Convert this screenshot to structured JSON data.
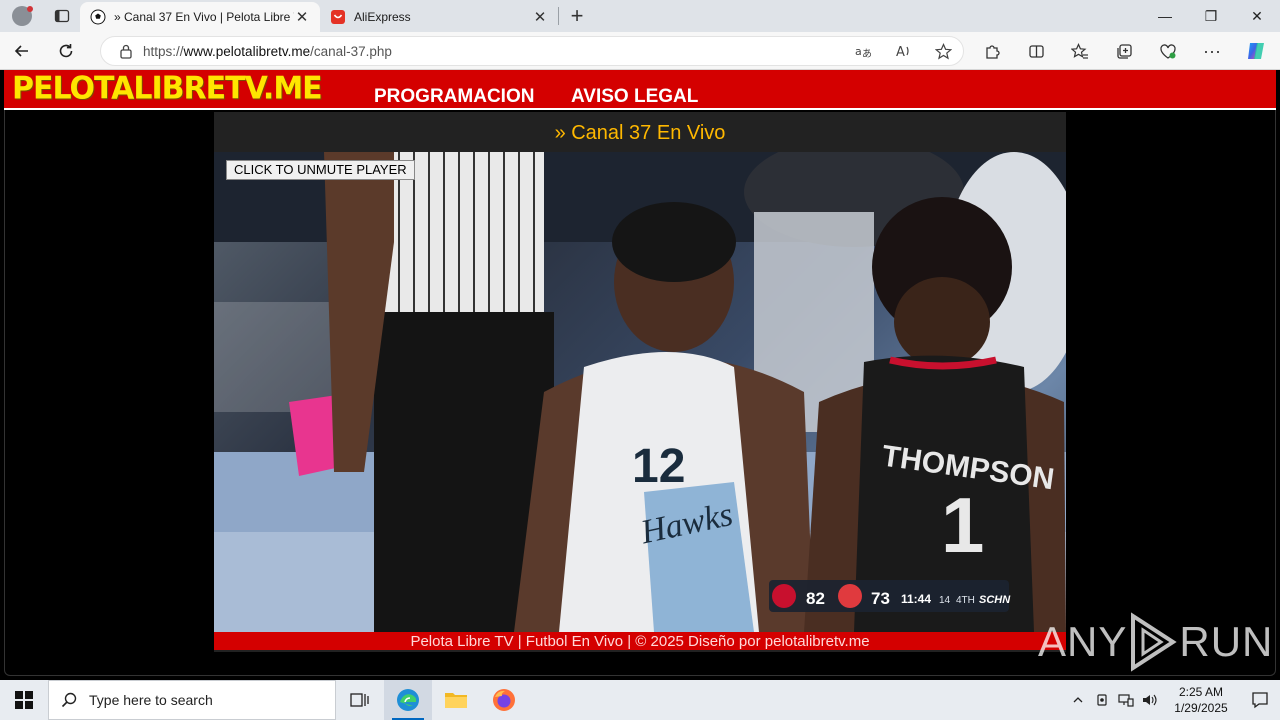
{
  "browser": {
    "tabs": [
      {
        "title": "» Canal 37 En Vivo | Pelota Libre TV",
        "active": true,
        "icon": "soccer-ball-icon"
      },
      {
        "title": "AliExpress",
        "active": false,
        "icon": "aliexpress-icon"
      }
    ],
    "url": {
      "scheme": "https://",
      "host": "www.pelotalibretv.me",
      "path": "/canal-37.php"
    }
  },
  "site": {
    "logo": "PELOTALIBRETV.ME",
    "nav": [
      "PROGRAMACION",
      "AVISO LEGAL"
    ],
    "channel_title": "» Canal 37 En Vivo",
    "unmute_label": "CLICK TO UNMUTE PLAYER",
    "footer": "Pelota Libre TV | Futbol En Vivo | © 2025 Diseño por pelotalibretv.me",
    "colors": {
      "header": "#d40000",
      "logo": "#ffe600",
      "title": "#ffb800"
    }
  },
  "video": {
    "jersey_left": {
      "number": "12",
      "team": "Hawks"
    },
    "jersey_right": {
      "name": "THOMPSON",
      "number": "1"
    },
    "scorebug": {
      "home_score": "82",
      "away_score": "73",
      "clock": "11:44",
      "shot_clock": "14",
      "period": "4TH",
      "network": "SCHN"
    }
  },
  "watermark": {
    "left": "ANY",
    "right": "RUN"
  },
  "taskbar": {
    "search_placeholder": "Type here to search",
    "time": "2:25 AM",
    "date": "1/29/2025"
  }
}
